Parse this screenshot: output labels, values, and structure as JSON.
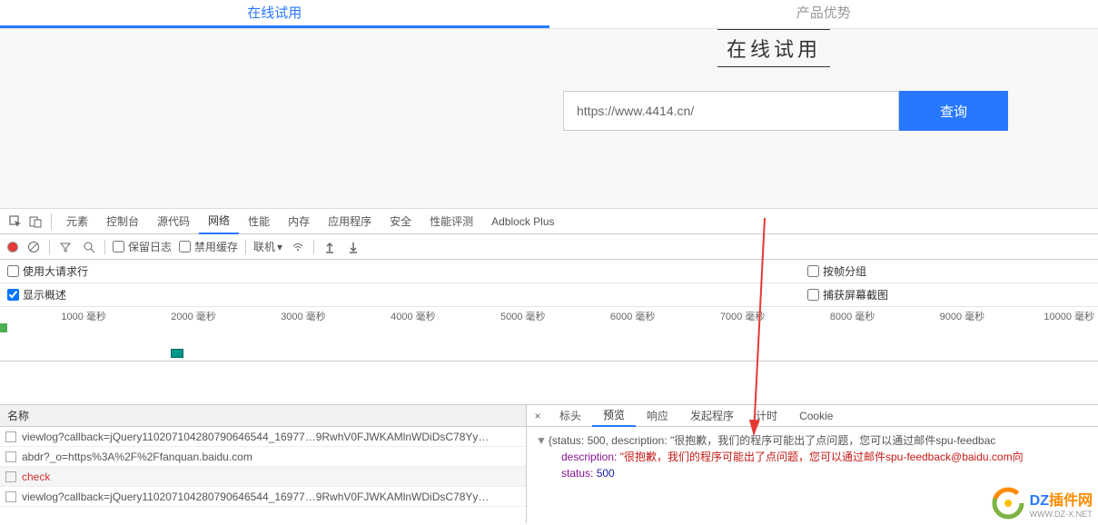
{
  "topTabs": {
    "online": "在线试用",
    "advantage": "产品优势"
  },
  "page": {
    "heading": "在线试用",
    "searchValue": "https://www.4414.cn/",
    "searchBtn": "查询"
  },
  "devtoolsTabs": {
    "elements": "元素",
    "console": "控制台",
    "sources": "源代码",
    "network": "网络",
    "performance": "性能",
    "memory": "内存",
    "application": "应用程序",
    "security": "安全",
    "lighthouse": "性能评测",
    "adblock": "Adblock Plus"
  },
  "toolbar": {
    "preserveLog": "保留日志",
    "disableCache": "禁用缓存",
    "throttle": "联机",
    "upload": "",
    "download": ""
  },
  "options": {
    "largeRows": "使用大请求行",
    "groupByFrame": "按帧分组",
    "showOverview": "显示概述",
    "captureScreenshot": "捕获屏幕截图"
  },
  "timeline": {
    "ticks": [
      "1000 毫秒",
      "2000 毫秒",
      "3000 毫秒",
      "4000 毫秒",
      "5000 毫秒",
      "6000 毫秒",
      "7000 毫秒",
      "8000 毫秒",
      "9000 毫秒",
      "10000 毫秒"
    ]
  },
  "requests": {
    "header": "名称",
    "rows": [
      "viewlog?callback=jQuery110207104280790646544_16977…9RwhV0FJWKAMlnWDiDsC78Yy…",
      "abdr?_o=https%3A%2F%2Ffanquan.baidu.com",
      "check",
      "viewlog?callback=jQuery110207104280790646544_16977…9RwhV0FJWKAMlnWDiDsC78Yy…"
    ]
  },
  "previewTabs": {
    "headers": "标头",
    "preview": "预览",
    "response": "响应",
    "initiator": "发起程序",
    "timing": "计时",
    "cookies": "Cookie"
  },
  "response": {
    "summary": "{status: 500, description: \"很抱歉，我们的程序可能出了点问题，您可以通过邮件spu-feedbac",
    "descKey": "description:",
    "descVal": "\"很抱歉，我们的程序可能出了点问题，您可以通过邮件spu-feedback@baidu.com向",
    "statusKey": "status:",
    "statusVal": "500"
  },
  "watermark": {
    "brand1": "DZ",
    "brand2": "插件网",
    "sub": "WWW.DZ-X.NET"
  }
}
